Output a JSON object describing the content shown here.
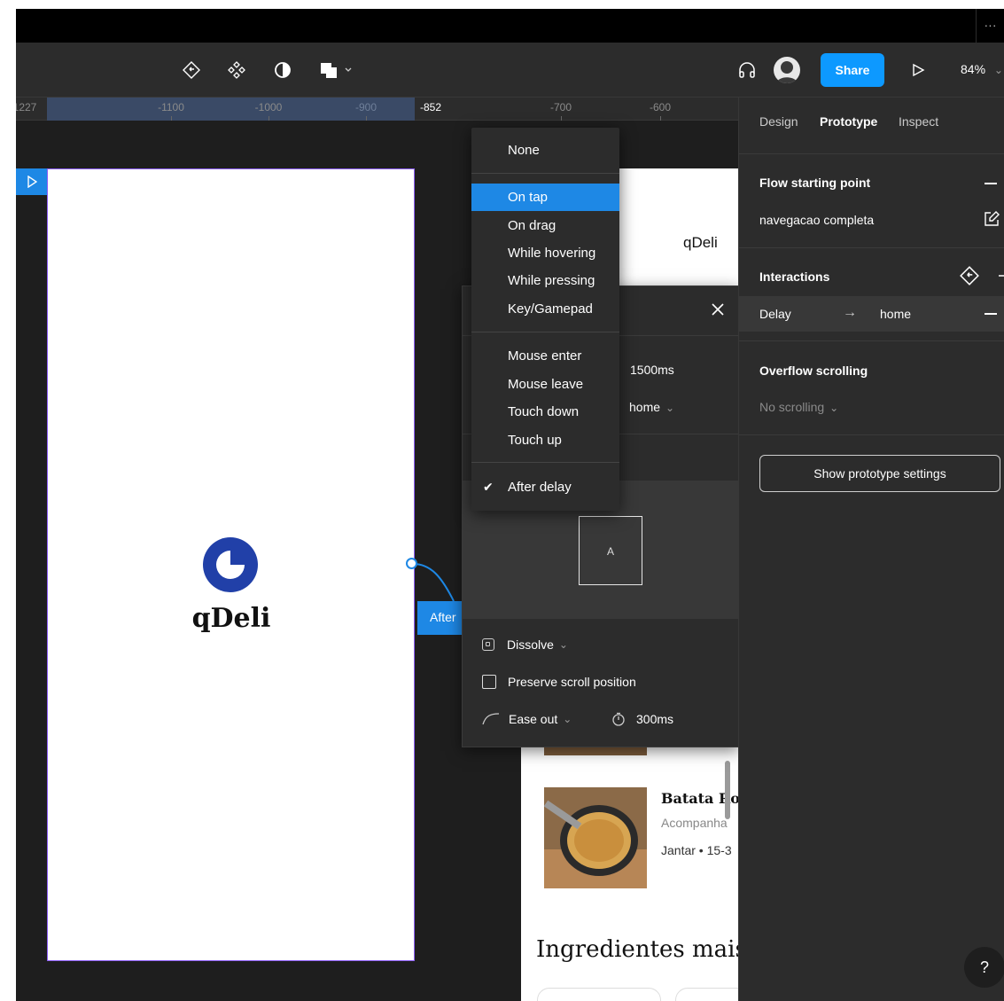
{
  "toolbar": {
    "share_label": "Share",
    "zoom_label": "84%"
  },
  "ruler": {
    "ticks": [
      "1227",
      "-1100",
      "-1000",
      "-900",
      "-852",
      "-700",
      "-600"
    ]
  },
  "canvas": {
    "frame1": {
      "logo_text": "qDeli"
    },
    "connection_label": "After",
    "frame2": {
      "title": "qDeli",
      "dish_title": "Batata Ros",
      "dish_subtitle": "Acompanha",
      "dish_meta": "Jantar • 15-3",
      "section_heading": "Ingredientes mais"
    }
  },
  "trigger_menu": {
    "items": [
      "None",
      "On tap",
      "On drag",
      "While hovering",
      "While pressing",
      "Key/Gamepad",
      "Mouse enter",
      "Mouse leave",
      "Touch down",
      "Touch up",
      "After delay"
    ],
    "highlighted": "On tap",
    "checked": "After delay"
  },
  "interaction_panel": {
    "delay_value": "1500ms",
    "destination": "home",
    "preview_label": "A",
    "animation": "Dissolve",
    "preserve_scroll_label": "Preserve scroll position",
    "easing": "Ease out",
    "duration": "300ms"
  },
  "right_panel": {
    "tabs": [
      "Design",
      "Prototype",
      "Inspect"
    ],
    "active_tab": "Prototype",
    "flow_heading": "Flow starting point",
    "flow_name": "navegacao completa",
    "interactions_heading": "Interactions",
    "interaction": {
      "trigger": "Delay",
      "arrow": "→",
      "target": "home"
    },
    "overflow_heading": "Overflow scrolling",
    "overflow_value": "No scrolling",
    "settings_button": "Show prototype settings"
  },
  "help_label": "?",
  "colors": {
    "accent": "#1e88e5",
    "share": "#0d99ff",
    "frame_border": "#8b5cf6",
    "logo": "#2140a8"
  }
}
